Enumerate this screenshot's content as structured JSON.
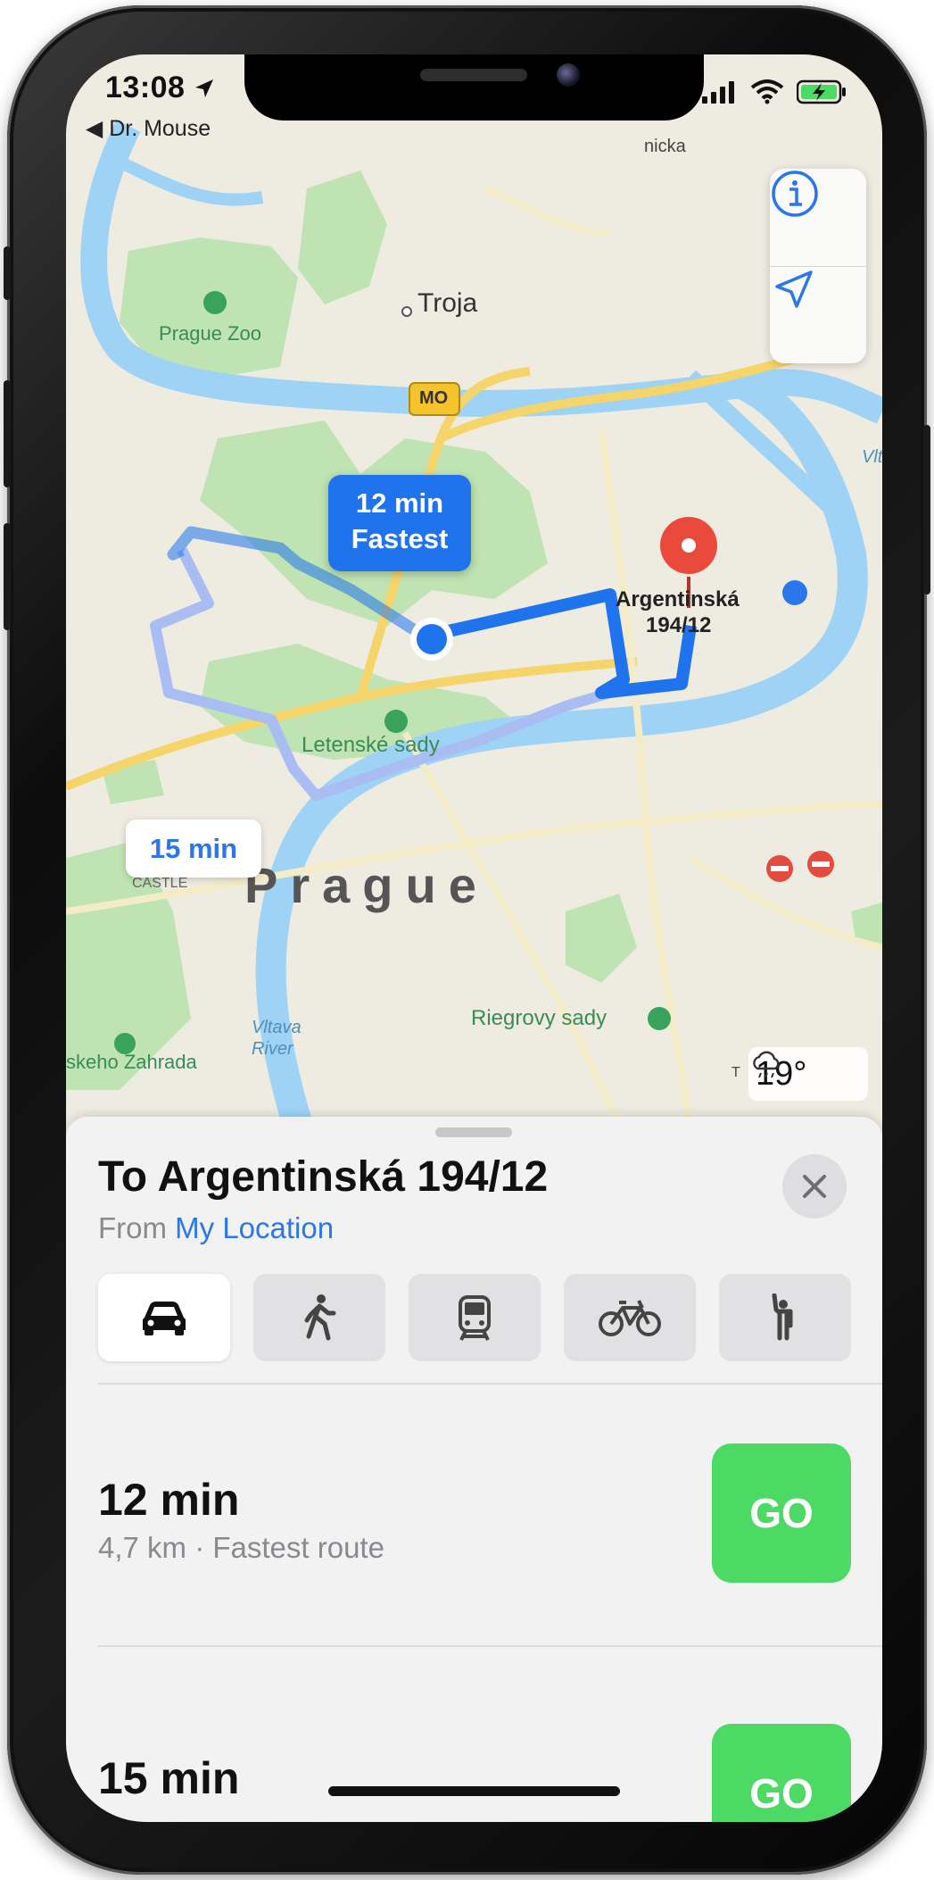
{
  "status_bar": {
    "time": "13:08",
    "back_label": "Dr. Mouse"
  },
  "map": {
    "labels": {
      "troja": "Troja",
      "prague_zoo": "Prague Zoo",
      "mo_badge": "MO",
      "letenske_sady": "Letenské sady",
      "destination_line1": "Argentinská",
      "destination_line2": "194/12",
      "city": "Prague",
      "castle": "CASTLE",
      "vltava_river": "Vltava River",
      "riegrovy_sady": "Riegrovy sady",
      "zahrada": "skeho Zahrada",
      "top_cut": "nicka",
      "vlt_cut": "Vlta",
      "tv_tower_cut": "T"
    },
    "route_callout_primary": {
      "time": "12 min",
      "label": "Fastest"
    },
    "route_callout_secondary": {
      "time": "15 min"
    },
    "weather": {
      "temperature": "19°",
      "icon": "cloud-rain-icon"
    },
    "colors": {
      "route_primary": "#1f73ec",
      "route_alt": "#a9bdf3",
      "water": "#9fd3f5",
      "park": "#bfe3b2",
      "destination_pin": "#ea4a3b",
      "go": "#4cd964"
    }
  },
  "map_controls": {
    "info_icon": "info-icon",
    "location_icon": "location-arrow-icon"
  },
  "sheet": {
    "title": "To Argentinská 194/12",
    "from_prefix": "From",
    "from_location": "My Location",
    "modes": [
      "car-icon",
      "walk-icon",
      "transit-icon",
      "bike-icon",
      "rideshare-icon"
    ],
    "routes": [
      {
        "time": "12 min",
        "details": "4,7 km · Fastest route",
        "go_label": "GO"
      },
      {
        "time": "15 min",
        "details": "",
        "go_label": "GO"
      }
    ]
  }
}
